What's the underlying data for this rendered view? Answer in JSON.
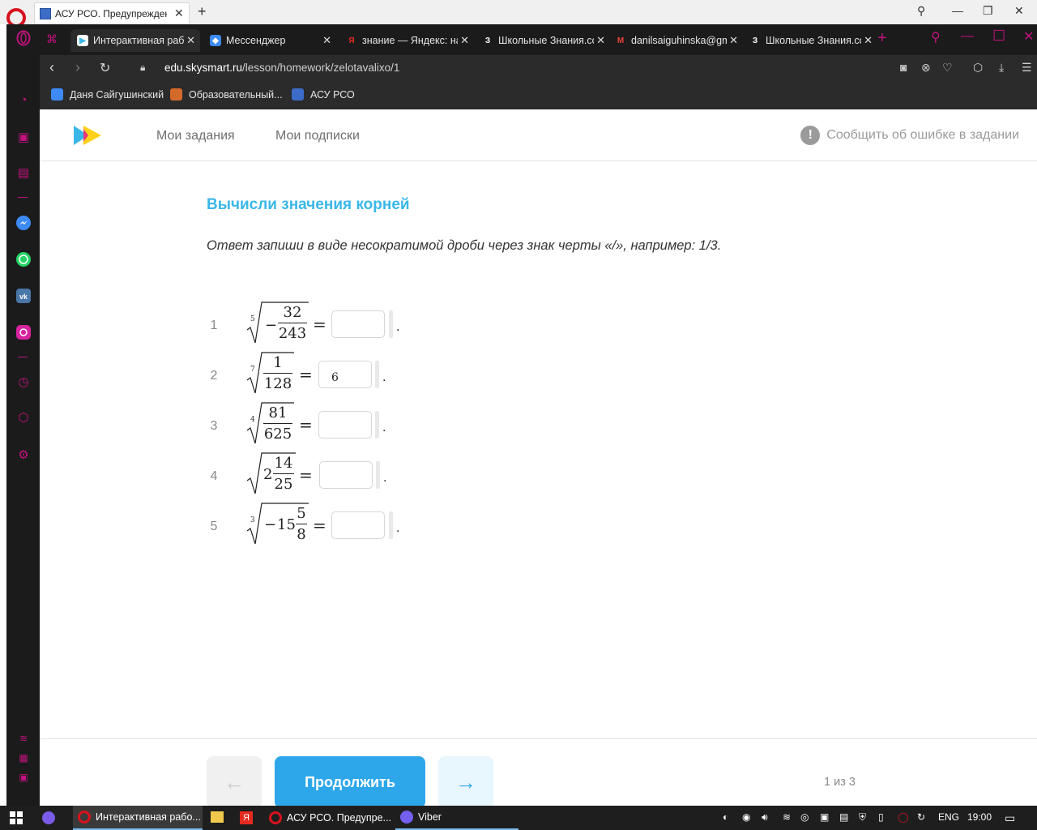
{
  "background_window": {
    "tab_title": "АСУ РСО. Предупреждение",
    "close": "✕",
    "new_tab": "+"
  },
  "browser": {
    "tabs": [
      {
        "label": "Интерактивная работа",
        "active": true,
        "color": "#3ab7e8"
      },
      {
        "label": "Мессенджер",
        "active": false,
        "color": "#3d8af7"
      },
      {
        "label": "знание — Яндекс: нашлось",
        "active": false,
        "color": "#e62b1e"
      },
      {
        "label": "Школьные Знания.com",
        "active": false,
        "color": "#ffffff"
      },
      {
        "label": "danilsaiguhinska@gmail.com",
        "active": false,
        "color": "#ea4335"
      },
      {
        "label": "Школьные Знания.com",
        "active": false,
        "color": "#ffffff"
      }
    ],
    "tab_close": "✕",
    "new_tab": "+",
    "url_host": "edu.skysmart.ru",
    "url_path": "/lesson/homework/zelotavalixo/1",
    "bookmarks": [
      {
        "label": "Даня Сайгушинский",
        "color": "#3d8af7"
      },
      {
        "label": "Образовательный...",
        "color": "#d46a2a"
      },
      {
        "label": "АСУ РСО",
        "color": "#3b6cc7"
      }
    ]
  },
  "site": {
    "nav": [
      "Мои задания",
      "Мои подписки"
    ],
    "report_label": "Сообщить об ошибке в задании",
    "report_icon": "!",
    "accent": "#3ab7e8",
    "title": "Вычисли значения корней",
    "instruction": "Ответ запиши в виде несократимой дроби через знак черты «/», например: 1/3.",
    "problems": [
      {
        "n": "1",
        "index": "5",
        "sign": "−",
        "whole": "",
        "num": "32",
        "den": "243",
        "answer": ""
      },
      {
        "n": "2",
        "index": "7",
        "sign": "",
        "whole": "",
        "num": "1",
        "den": "128",
        "answer": "6"
      },
      {
        "n": "3",
        "index": "4",
        "sign": "",
        "whole": "",
        "num": "81",
        "den": "625",
        "answer": ""
      },
      {
        "n": "4",
        "index": "",
        "sign": "",
        "whole": "2",
        "num": "14",
        "den": "25",
        "answer": ""
      },
      {
        "n": "5",
        "index": "3",
        "sign": "−",
        "whole": "15",
        "num": "5",
        "den": "8",
        "answer": ""
      }
    ],
    "equals": "=",
    "period": ".",
    "prev_arrow": "←",
    "next_arrow": "→",
    "continue_label": "Продолжить",
    "pager": "1 из 3"
  },
  "taskbar": {
    "items": [
      {
        "label": "Интерактивная рабо...",
        "active": true
      },
      {
        "label": "АСУ РСО. Предупре...",
        "active": false
      },
      {
        "label": "Viber",
        "active": false
      }
    ],
    "lang": "ENG",
    "time": "19:00"
  }
}
